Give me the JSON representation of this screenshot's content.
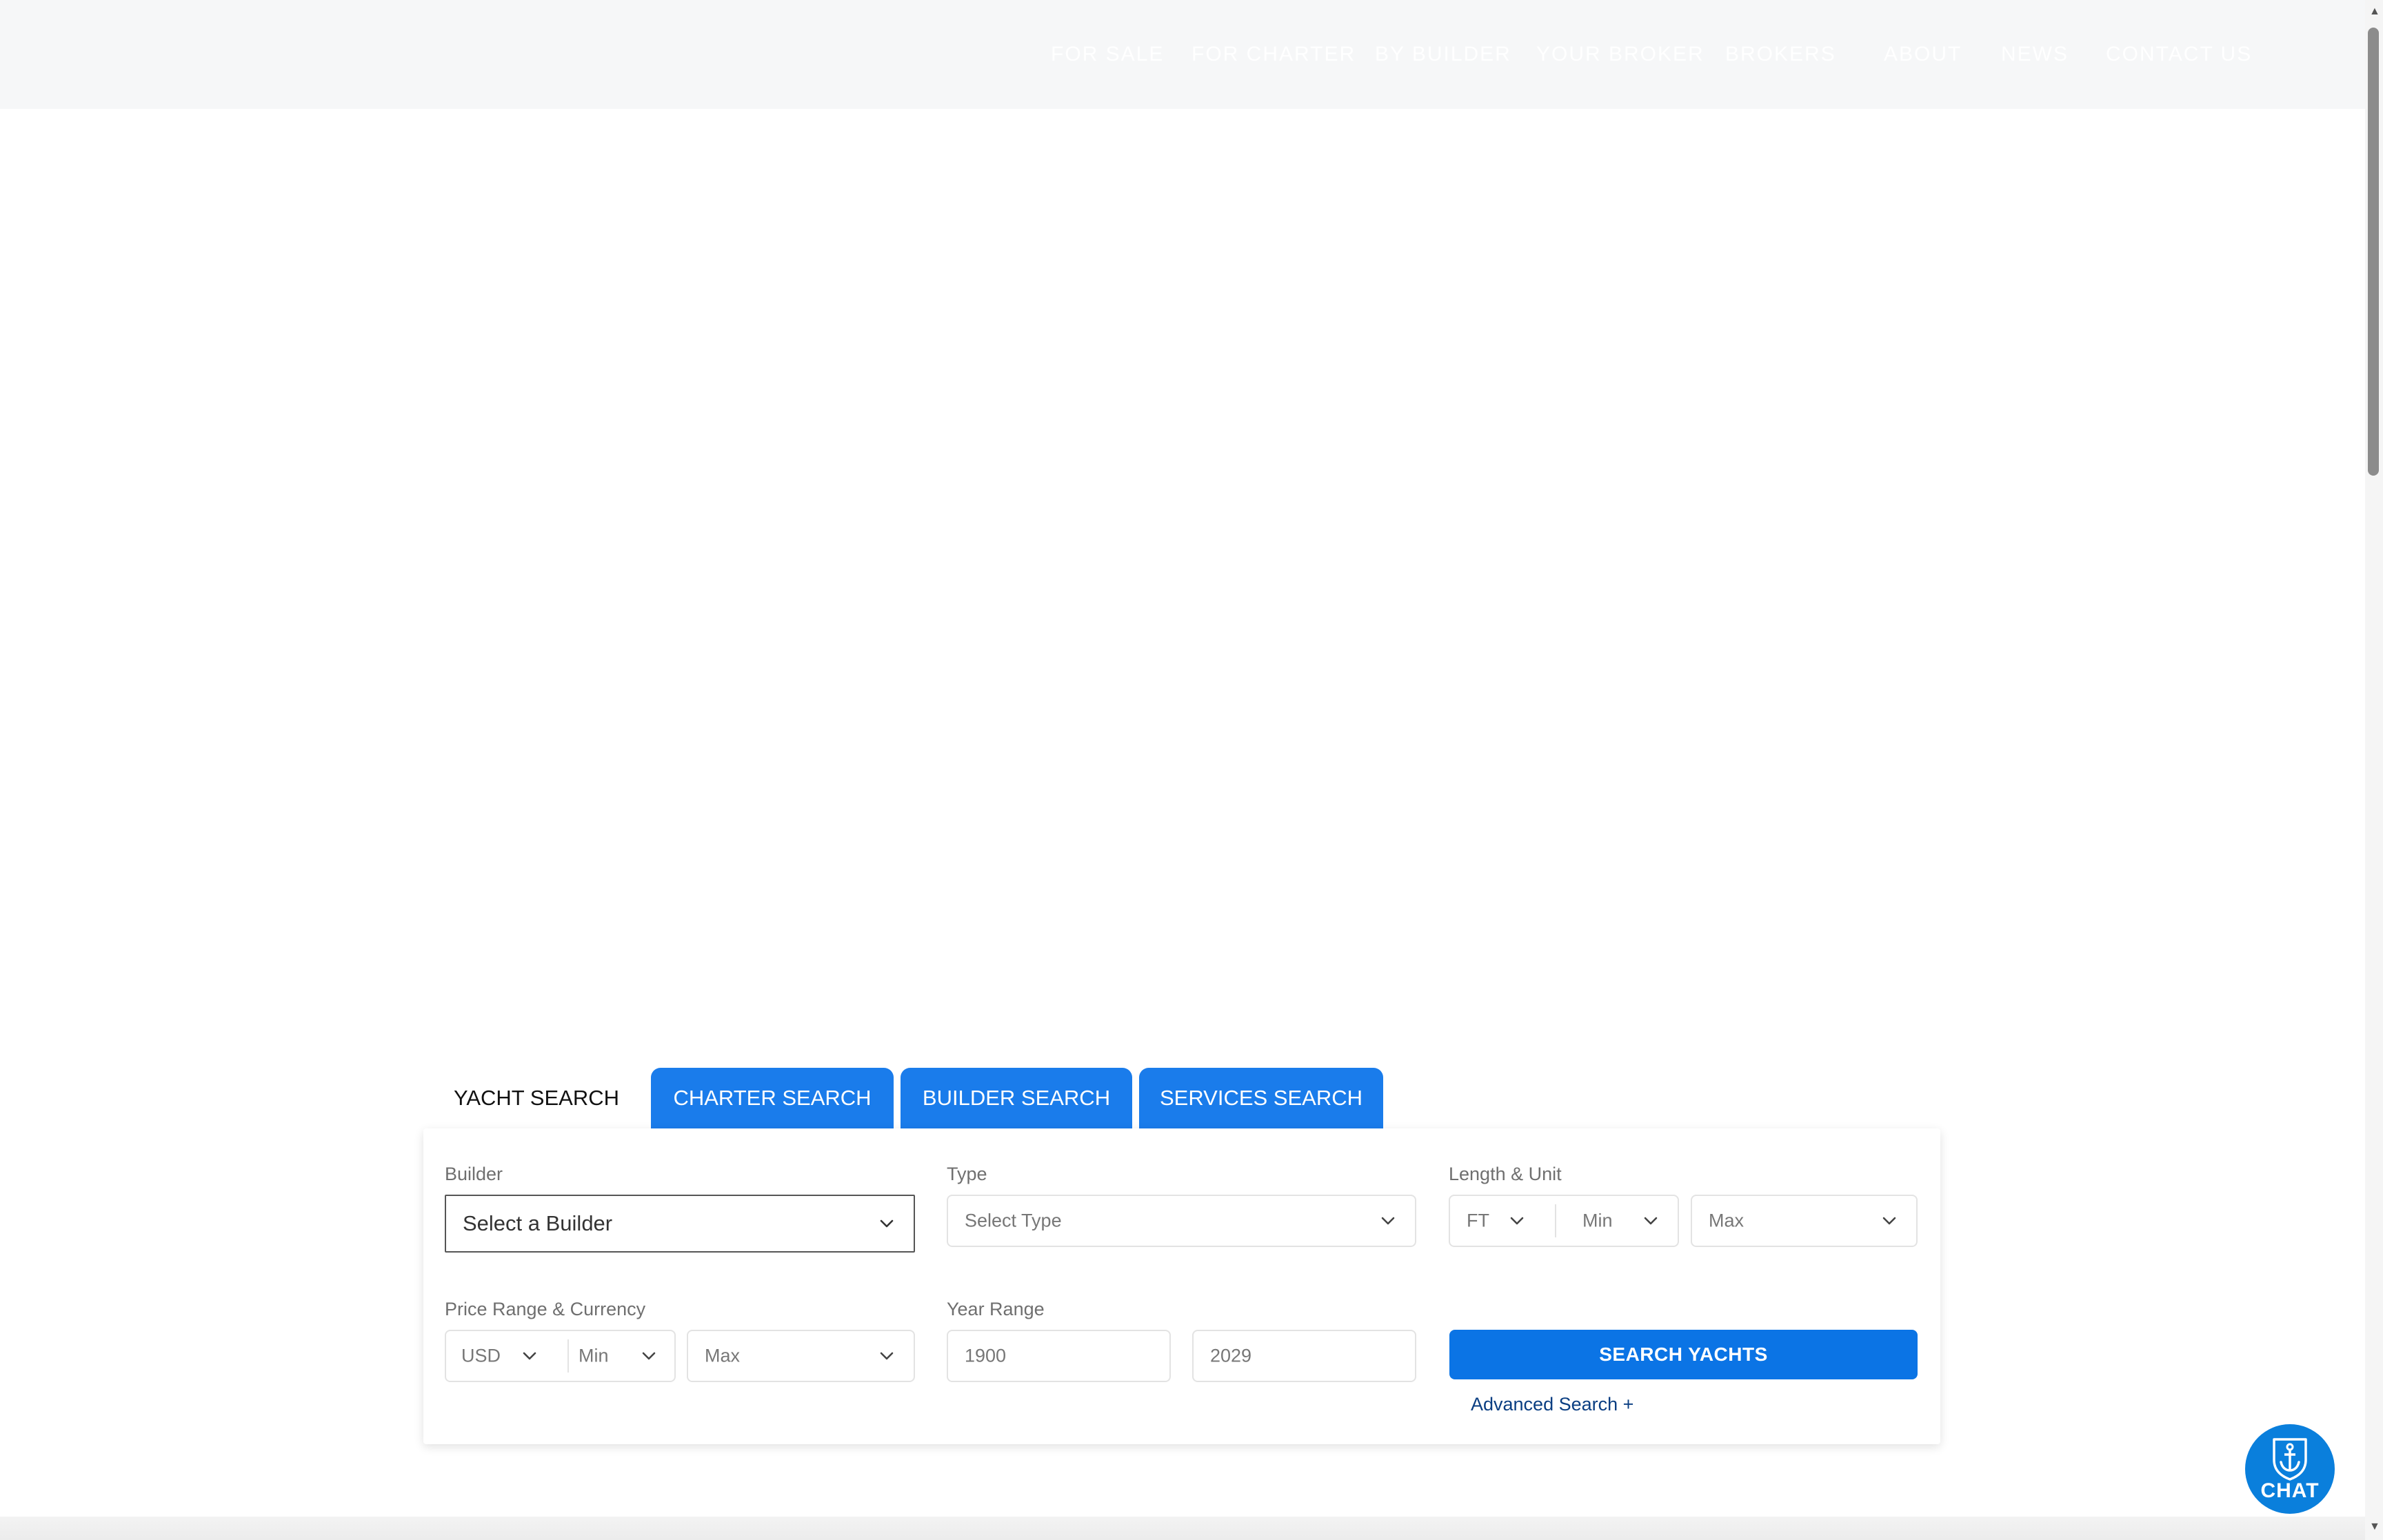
{
  "nav": {
    "items": [
      "FOR SALE",
      "FOR CHARTER",
      "BY BUILDER",
      "YOUR BROKER",
      "BROKERS",
      "ABOUT",
      "NEWS",
      "CONTACT US"
    ]
  },
  "tabs": [
    "YACHT SEARCH",
    "CHARTER SEARCH",
    "BUILDER SEARCH",
    "SERVICES SEARCH"
  ],
  "search": {
    "builder": {
      "label": "Builder",
      "value": "Select a Builder"
    },
    "type": {
      "label": "Type",
      "value": "Select Type"
    },
    "length": {
      "label": "Length & Unit",
      "unit": "FT",
      "min": "Min",
      "max": "Max"
    },
    "price": {
      "label": "Price Range & Currency",
      "currency": "USD",
      "min": "Min",
      "max": "Max"
    },
    "year": {
      "label": "Year Range",
      "from": "1900",
      "to": "2029"
    },
    "submit_label": "SEARCH YACHTS",
    "advanced_label": "Advanced Search +"
  },
  "chat": {
    "label": "CHAT"
  },
  "colors": {
    "accent": "#1a7ceb",
    "button": "#0b74e5",
    "link": "#0a3e82"
  }
}
